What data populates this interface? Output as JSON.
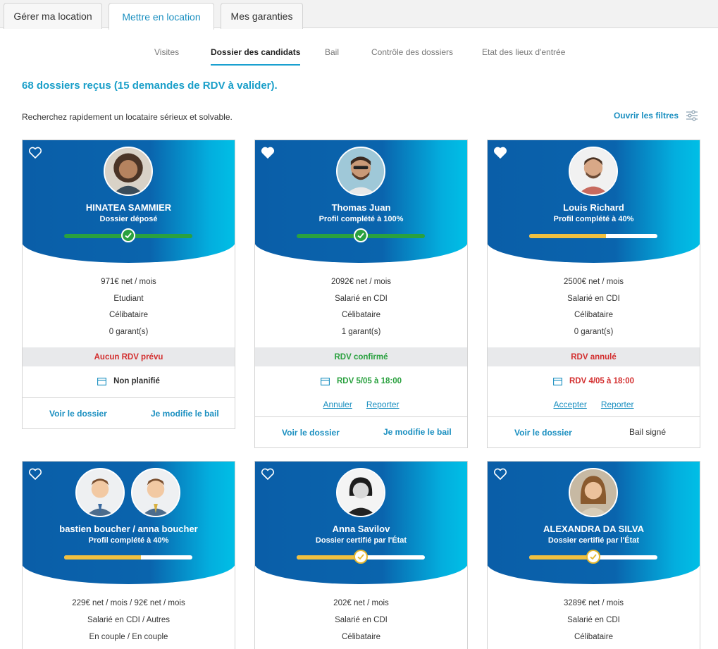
{
  "top_tabs": [
    {
      "label": "Gérer ma location"
    },
    {
      "label": "Mettre en location"
    },
    {
      "label": "Mes garanties"
    }
  ],
  "sub_tabs": [
    {
      "label": "Visites"
    },
    {
      "label": "Dossier des candidats"
    },
    {
      "label": "Bail"
    },
    {
      "label": "Contrôle des dossiers"
    },
    {
      "label": "Etat des lieux d'entrée"
    }
  ],
  "summary": {
    "title": "68 dossiers reçus (15 demandes de RDV à valider)."
  },
  "search": {
    "hint": "Recherchez rapidement un locataire sérieux et solvable.",
    "filters_label": "Ouvrir les filtres"
  },
  "colors": {
    "accent": "#1a9fc9",
    "header_dark": "#0a5ea8",
    "header_light": "#00bfe6",
    "green": "#2aa13f",
    "yellow": "#f0c040",
    "red": "#d32f2f"
  },
  "cards": [
    {
      "name": "HINATEA SAMMIER",
      "status": "Dossier déposé",
      "favorite": false,
      "income": "971€ net / mois",
      "situation": "Etudiant",
      "family": "Célibataire",
      "guarantors": "0 garant(s)",
      "rdv_status": "Aucun RDV prévu",
      "rdv_date": "Non planifié",
      "view": "Voir le dossier",
      "modify": "Je modifie le bail"
    },
    {
      "name": "Thomas Juan",
      "status": "Profil complété à 100%",
      "favorite": true,
      "income": "2092€ net / mois",
      "situation": "Salarié en CDI",
      "family": "Célibataire",
      "guarantors": "1 garant(s)",
      "rdv_status": "RDV confirmé",
      "rdv_date": "RDV 5/05 à 18:00",
      "action_1": "Annuler",
      "action_2": "Reporter",
      "view": "Voir le dossier",
      "modify": "Je modifie le bail"
    },
    {
      "name": "Louis Richard",
      "status": "Profil complété à 40%",
      "favorite": true,
      "income": "2500€ net / mois",
      "situation": "Salarié en CDI",
      "family": "Célibataire",
      "guarantors": "0 garant(s)",
      "rdv_status": "RDV annulé",
      "rdv_date": "RDV 4/05 à 18:00",
      "action_1": "Accepter",
      "action_2": "Reporter",
      "view": "Voir le dossier",
      "lease_status": "Bail signé"
    },
    {
      "name": "bastien boucher / anna boucher",
      "status": "Profil complété à 40%",
      "favorite": false,
      "income": "229€ net / mois / 92€ net / mois",
      "situation": "Salarié en CDI / Autres",
      "family": "En couple / En couple"
    },
    {
      "name": "Anna Savilov",
      "status": "Dossier certifié par l'État",
      "favorite": false,
      "income": "202€ net / mois",
      "situation": "Salarié en CDI",
      "family": "Célibataire"
    },
    {
      "name": "ALEXANDRA DA SILVA",
      "status": "Dossier certifié par l'État",
      "favorite": false,
      "income": "3289€ net / mois",
      "situation": "Salarié en CDI",
      "family": "Célibataire"
    }
  ]
}
